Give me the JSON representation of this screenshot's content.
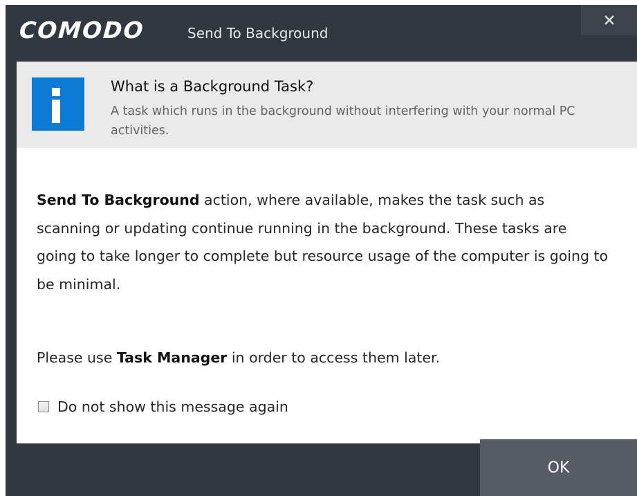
{
  "window": {
    "brand": "COMODO",
    "title": "Send To Background",
    "close_icon": "close-icon"
  },
  "info": {
    "icon": "info-icon",
    "title": "What is a Background Task?",
    "description": "A task which runs in the background without interfering with your normal PC activities."
  },
  "body": {
    "para1_emphasis": "Send To Background",
    "para1_rest": " action, where available, makes the task such as scanning or updating continue running in the background. These tasks are going to take longer to complete but resource usage of the computer is going to be minimal.",
    "para2_prefix": "Please use ",
    "para2_emphasis": "Task Manager",
    "para2_suffix": " in order to access them later."
  },
  "checkbox": {
    "label": "Do not show this message again",
    "checked": false
  },
  "buttons": {
    "ok_label": "OK"
  },
  "colors": {
    "frame": "#323840",
    "header_bg": "#eaeaeb",
    "info_icon": "#0d7bd6",
    "ok_button": "#575c64"
  }
}
